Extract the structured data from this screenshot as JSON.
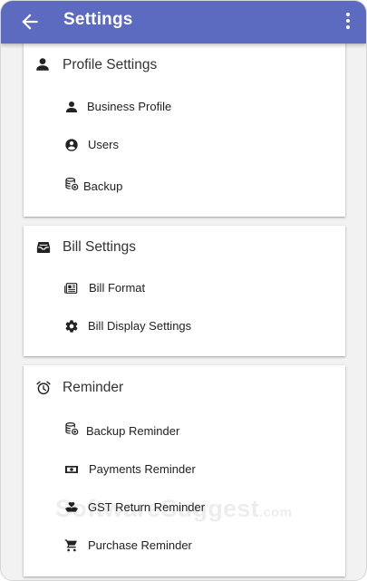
{
  "appbar": {
    "title": "Settings"
  },
  "profile": {
    "title": "Profile Settings",
    "items": [
      {
        "label": "Business Profile",
        "icon": "person-icon"
      },
      {
        "label": "Users",
        "icon": "account-circle-icon"
      },
      {
        "label": "Backup",
        "icon": "database-backup-icon"
      }
    ]
  },
  "bill": {
    "title": "Bill Settings",
    "items": [
      {
        "label": "Bill Format",
        "icon": "newspaper-icon"
      },
      {
        "label": "Bill Display Settings",
        "icon": "gear-icon"
      }
    ]
  },
  "reminder": {
    "title": "Reminder",
    "items": [
      {
        "label": "Backup Reminder",
        "icon": "database-backup-icon"
      },
      {
        "label": "Payments Reminder",
        "icon": "money-icon"
      },
      {
        "label": "GST Return Reminder",
        "icon": "hand-heart-icon"
      },
      {
        "label": "Purchase Reminder",
        "icon": "cart-icon"
      }
    ]
  },
  "watermark": {
    "main": "SoftwareSuggest",
    "suffix": ".com"
  },
  "colors": {
    "appbar": "#5c6bc0",
    "background": "#f2f2f2",
    "card": "#ffffff"
  }
}
